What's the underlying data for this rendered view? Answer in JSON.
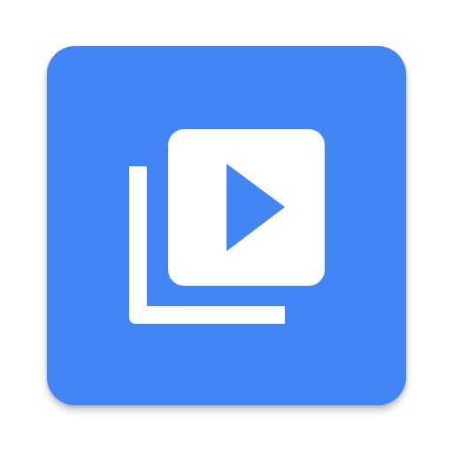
{
  "icon": {
    "name": "video-library-icon",
    "background_color": "#4285F4",
    "glyph_color": "#FFFFFF",
    "glyph_parts": [
      "stacked-frame",
      "play-triangle"
    ]
  }
}
